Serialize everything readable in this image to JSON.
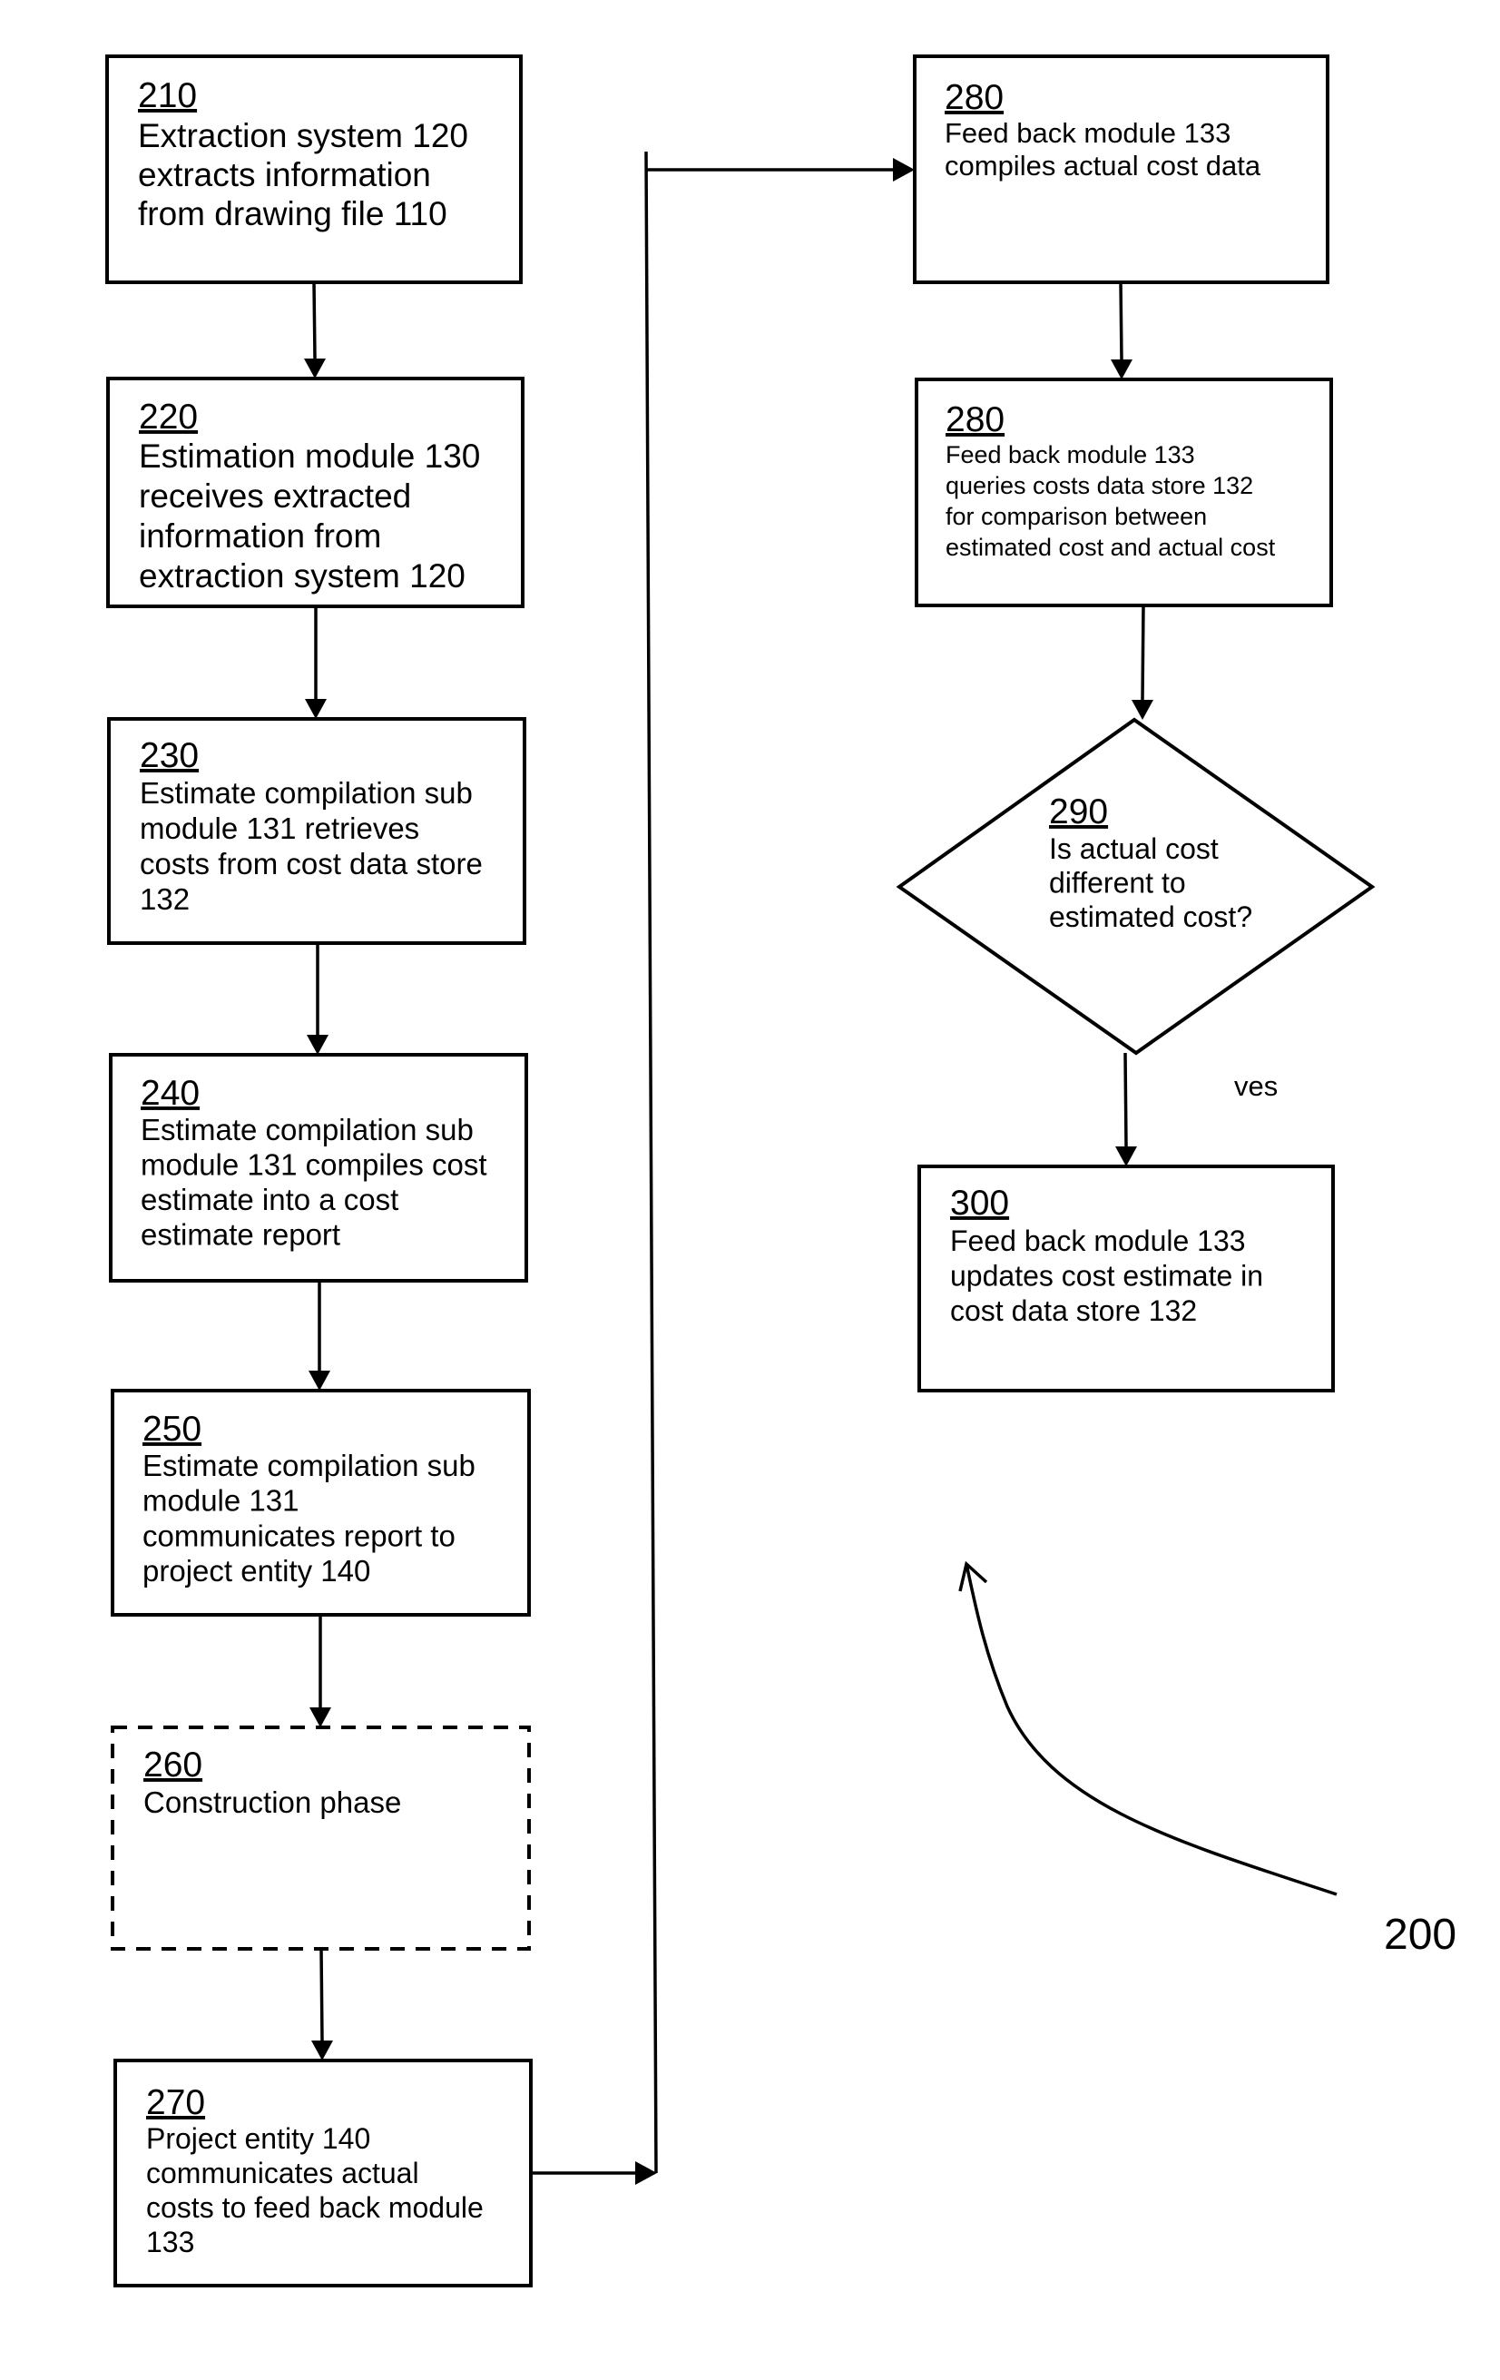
{
  "figure": {
    "reference_label": "200",
    "steps": [
      {
        "id": "210",
        "lines": [
          "Extraction system 120",
          "extracts information",
          "from drawing file 110"
        ]
      },
      {
        "id": "220",
        "lines": [
          "Estimation module 130",
          "receives extracted",
          "information from",
          "extraction system 120"
        ]
      },
      {
        "id": "230",
        "lines": [
          "Estimate compilation sub",
          "module 131 retrieves",
          "costs from cost data store",
          "132"
        ]
      },
      {
        "id": "240",
        "lines": [
          "Estimate compilation sub",
          "module 131 compiles cost",
          "estimate into a cost",
          "estimate report"
        ]
      },
      {
        "id": "250",
        "lines": [
          "Estimate compilation sub",
          "module 131",
          "communicates report to",
          "project entity 140"
        ]
      },
      {
        "id": "260",
        "lines": [
          "Construction phase"
        ],
        "style": "dashed"
      },
      {
        "id": "270",
        "lines": [
          "Project entity 140",
          "communicates actual",
          "costs to feed back module",
          "133"
        ]
      },
      {
        "id": "280",
        "lines": [
          "Feed back module 133",
          "compiles actual cost data"
        ]
      },
      {
        "id": "280",
        "lines": [
          "Feed back module 133",
          "queries costs data store 132",
          "for comparison between",
          "estimated cost and actual cost"
        ]
      },
      {
        "id": "290",
        "lines": [
          "Is actual cost",
          "different to",
          "estimated cost?"
        ],
        "shape": "decision"
      },
      {
        "id": "300",
        "lines": [
          "Feed back module 133",
          "updates cost estimate in",
          "cost data store 132"
        ]
      }
    ],
    "edge_labels": {
      "decision_yes": "ves"
    }
  }
}
